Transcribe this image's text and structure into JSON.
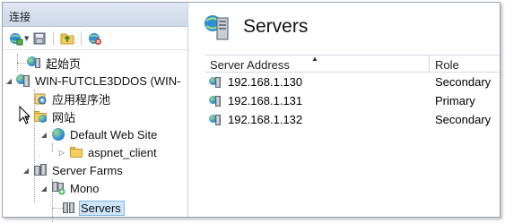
{
  "left_pane": {
    "header": "连接",
    "toolbar": {
      "connect_icon": "globe-connect-icon",
      "save_icon": "floppy-save-icon",
      "up_icon": "folder-up-icon",
      "disconnect_icon": "globe-disconnect-icon"
    },
    "tree": {
      "start_page": "起始页",
      "server_node": "WIN-FUTCLE3DDOS (WIN-",
      "app_pools": "应用程序池",
      "sites": "网站",
      "default_site": "Default Web Site",
      "aspnet_client": "aspnet_client",
      "server_farms": "Server Farms",
      "farm_mono": "Mono",
      "farm_servers": "Servers"
    }
  },
  "right_pane": {
    "title": "Servers",
    "columns": {
      "address": "Server Address",
      "role": "Role"
    },
    "rows": [
      {
        "address": "192.168.1.130",
        "role": "Secondary"
      },
      {
        "address": "192.168.1.131",
        "role": "Primary"
      },
      {
        "address": "192.168.1.132",
        "role": "Secondary"
      }
    ]
  },
  "colors": {
    "header_bg": "#cdd9e8",
    "selection_bg": "#cfe5fa",
    "selection_border": "#7fb4e6",
    "grid_line": "#d5dbe3"
  }
}
